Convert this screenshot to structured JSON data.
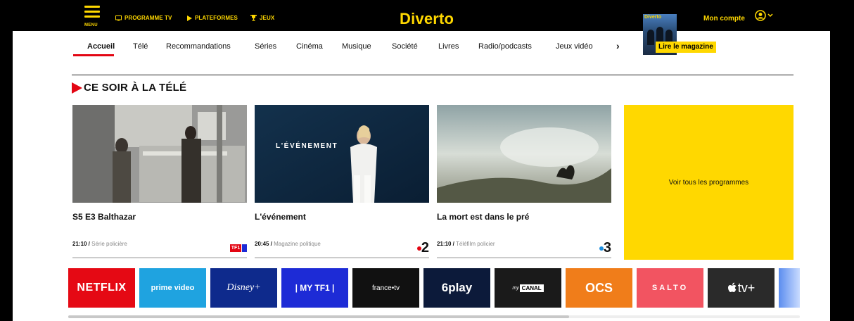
{
  "header": {
    "menu_label": "MENU",
    "links": [
      {
        "id": "programme-tv",
        "label": "PROGRAMME TV",
        "icon": "tv-icon"
      },
      {
        "id": "plateformes",
        "label": "PLATEFORMES",
        "icon": "play-icon"
      },
      {
        "id": "jeux",
        "label": "JEUX",
        "icon": "trophy-icon"
      }
    ],
    "brand": "Diverto",
    "account_label": "Mon compte",
    "magazine": {
      "cover_title": "Diverto",
      "read_label": "Lire le magazine"
    }
  },
  "nav": {
    "tabs": [
      "Accueil",
      "Télé",
      "Recommandations",
      "Séries",
      "Cinéma",
      "Musique",
      "Société",
      "Livres",
      "Radio/podcasts",
      "Jeux vidéo"
    ],
    "active": "Accueil",
    "next_icon": "›"
  },
  "section": {
    "title": "CE SOIR À LA TÉLÉ",
    "overlay_text": "L'ÉVÉNEMENT",
    "cards": [
      {
        "title": "S5 E3 Balthazar",
        "time": "21:10 /",
        "genre": "Série policière",
        "channel": "TF1"
      },
      {
        "title": "L'événement",
        "time": "20:45 /",
        "genre": "Magazine politique",
        "channel": "2"
      },
      {
        "title": "La mort est dans le pré",
        "time": "21:10 /",
        "genre": "Téléfilm policier",
        "channel": "3"
      }
    ],
    "all_programs_label": "Voir tous les programmes"
  },
  "platforms": [
    {
      "name": "NETFLIX",
      "bg": "#e50914",
      "color": "#ffffff"
    },
    {
      "name": "prime video",
      "bg": "#1fa3e0",
      "color": "#ffffff"
    },
    {
      "name": "Disney+",
      "bg": "#0e2a8c",
      "color": "#ffffff"
    },
    {
      "name": "| MY TF1 |",
      "bg": "#1d2bd6",
      "color": "#ffffff"
    },
    {
      "name": "france•tv",
      "bg": "#111111",
      "color": "#ffffff"
    },
    {
      "name": "6play",
      "bg": "#0c1a3a",
      "color": "#ffffff"
    },
    {
      "name": "CANAL",
      "my_prefix": "my",
      "bg": "#1a1a1a",
      "color": "#ffffff"
    },
    {
      "name": "OCS",
      "bg": "#f07d1a",
      "color": "#ffffff"
    },
    {
      "name": "SALTO",
      "bg": "#f25461",
      "color": "#ffffff"
    },
    {
      "name": "tv+",
      "bg": "#2a2a2a",
      "color": "#ffffff"
    }
  ],
  "colors": {
    "accent_yellow": "#ffd800",
    "accent_red": "#e30613"
  }
}
